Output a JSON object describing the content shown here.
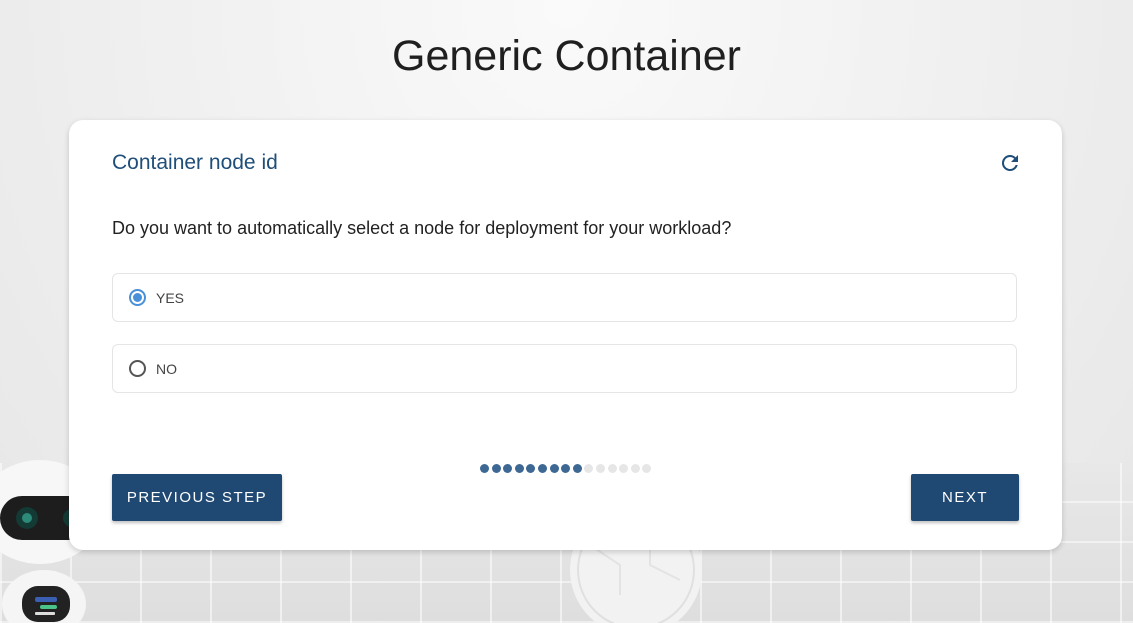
{
  "page": {
    "title": "Generic Container"
  },
  "card": {
    "title": "Container node id",
    "refresh_icon": "refresh-icon",
    "question": "Do you want to automatically select a node for deployment for your workload?",
    "options": [
      {
        "label": "YES",
        "selected": true
      },
      {
        "label": "NO",
        "selected": false
      }
    ],
    "progress": {
      "total_steps": 15,
      "completed_steps": 9
    },
    "buttons": {
      "previous": "PREVIOUS STEP",
      "next": "NEXT"
    }
  },
  "colors": {
    "accent": "#1f4873",
    "title": "#1f4e79",
    "radio_selected": "#4a90d9",
    "step_done": "#3e6894",
    "step_pending": "#e6e6e6"
  }
}
